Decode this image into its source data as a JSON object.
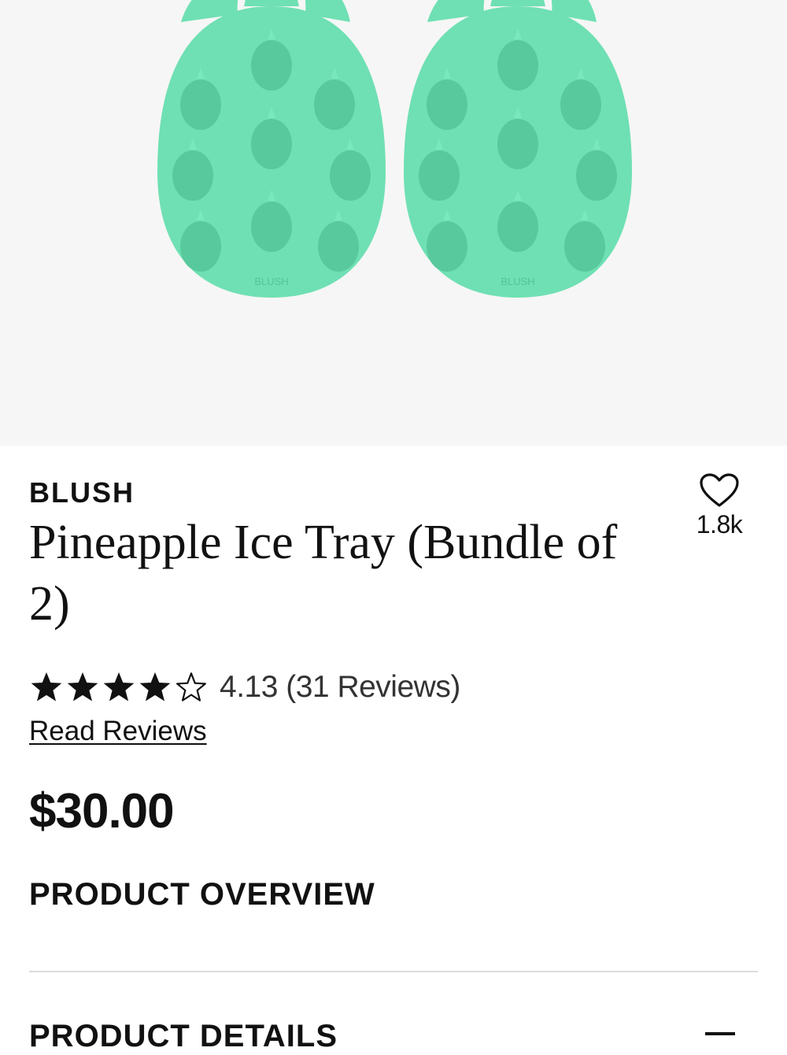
{
  "product_image": {
    "tray_brand_mark": "BLUSH",
    "color": "#6fe0b3"
  },
  "brand": "BLUSH",
  "title": "Pineapple Ice Tray (Bundle of 2)",
  "favorite": {
    "icon": "heart-outline-icon",
    "count": "1.8k"
  },
  "rating": {
    "value": 4.13,
    "stars_filled": 4,
    "stars_total": 5,
    "text": "4.13 (31 Reviews)"
  },
  "read_reviews_label": "Read Reviews",
  "price": "$30.00",
  "sections": {
    "overview": "PRODUCT OVERVIEW",
    "details": "PRODUCT DETAILS",
    "details_toggle_icon": "minus-icon"
  }
}
